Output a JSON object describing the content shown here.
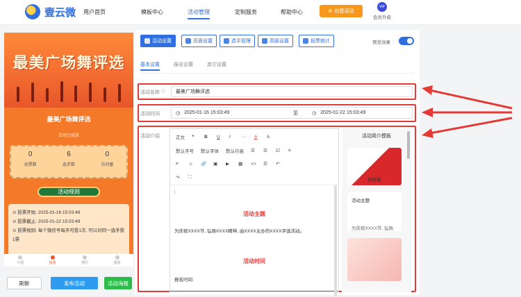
{
  "header": {
    "logo_text": "壹云微",
    "nav": [
      "用户首页",
      "模板中心",
      "活动管理",
      "定制服务",
      "帮助中心"
    ],
    "active_nav": "活动管理",
    "create_button": "创建活动",
    "vip_badge": "VIP",
    "vip_label": "会员升级"
  },
  "preview": {
    "banner_title": "最美广场舞评选",
    "activity_title": "最美广场舞评选",
    "status": "活动已结束",
    "stats": [
      {
        "value": "0",
        "label": "总票数"
      },
      {
        "value": "6",
        "label": "选手数"
      },
      {
        "value": "0",
        "label": "访问量"
      }
    ],
    "rules_button": "活动规则",
    "rules": [
      "投票开始: 2025-01-16 15:03:49",
      "投票截止: 2025-01-22 15:03:49",
      "投票规则: 每个微信号每天可投1次, 可以对同一选手投1票"
    ],
    "tabbar": [
      "介绍",
      "投票",
      "排行",
      "报名"
    ]
  },
  "bottom_actions": {
    "refresh": "刷新",
    "publish": "发布活动",
    "poster": "活动海报"
  },
  "toolbar": {
    "buttons": [
      "活动设置",
      "页面设置",
      "选手管理",
      "高级设置",
      "投票统计"
    ],
    "preview_label": "预览效果"
  },
  "subtabs": [
    "基本设置",
    "报名设置",
    "其它设置"
  ],
  "form": {
    "name_label": "活动名称",
    "name_value": "最美广场舞评选",
    "time_label": "活动时间",
    "start_time": "2025-01-16 15:03:49",
    "time_sep": "至",
    "end_time": "2025-01-22 15:03:49",
    "intro_label": "活动介绍"
  },
  "editor": {
    "row1": [
      "正文",
      "❝",
      "B",
      "U",
      "I",
      "···",
      "A",
      "A"
    ],
    "row2": [
      "默认字号",
      "默认字体",
      "默认行高",
      "☰",
      "☰",
      "☑",
      "≡"
    ],
    "row3": [
      "≡",
      "☺",
      "🔗",
      "▣",
      "▶",
      "▦",
      "<>",
      "☰",
      "↶"
    ],
    "row4": [
      "↷",
      "⛶"
    ],
    "heading1": "活动主题",
    "paragraph1": "为庆祝XXXX节, 弘扬XXXX精神, 由XXXX主办的XXXX评选活动。",
    "heading2": "活动时间",
    "paragraph2": "报名时间:"
  },
  "templates": {
    "title": "活动简介模板",
    "items": [
      "迎新春",
      "活动主题",
      "为庆祝XXXX节, 弘扬",
      ""
    ]
  },
  "colors": {
    "accent": "#2f6fe0",
    "highlight": "#e53935",
    "orange": "#f7981d",
    "green": "#1f7a3a"
  }
}
